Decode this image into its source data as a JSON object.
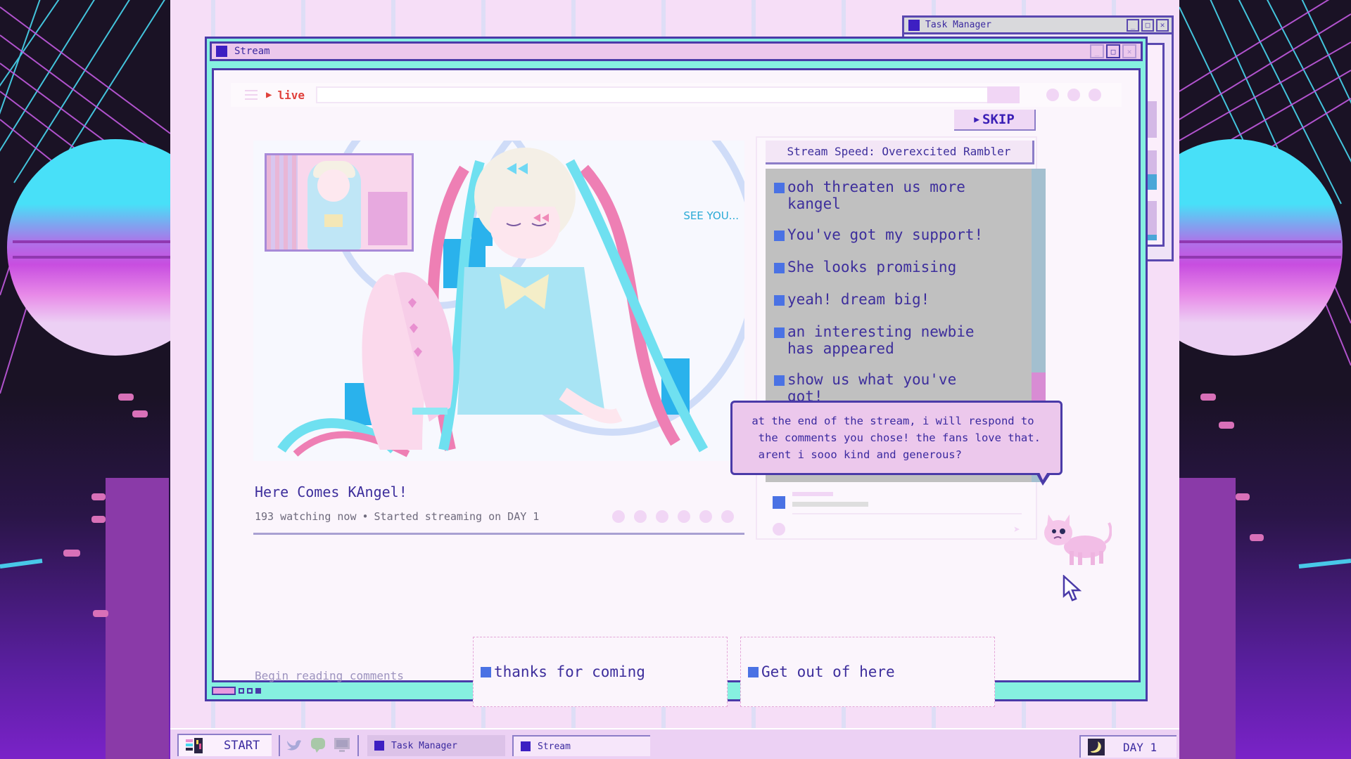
{
  "task_manager_window": {
    "title": "Task Manager",
    "icon": "window-icon",
    "controls": [
      "minimize",
      "maximize",
      "close"
    ]
  },
  "stream_window": {
    "title": "Stream",
    "icon": "window-icon",
    "controls": [
      "minimize",
      "maximize",
      "close"
    ],
    "live_label": "live",
    "live_icon": "play-icon",
    "menu_icon": "hamburger-icon"
  },
  "video": {
    "overlay_text": "SEE YOU...",
    "thumbnail": "character-thumbnail"
  },
  "stream_info": {
    "title": "Here Comes KAngel!",
    "watching": "193 watching now",
    "separator": "•",
    "started": "Started streaming on DAY 1"
  },
  "skip_button": {
    "label": "SKIP",
    "icon": "play-icon"
  },
  "stream_speed": "Stream Speed: Overexcited Rambler",
  "comments": [
    {
      "text": "ooh threaten us more\nkangel"
    },
    {
      "text": "You've got my support!"
    },
    {
      "text": "She looks promising"
    },
    {
      "text": "yeah! dream big!"
    },
    {
      "text": "an interesting newbie\nhas appeared"
    },
    {
      "text": "show us what you've\ngot!"
    }
  ],
  "speech_bubble": " at the end of the stream, i will respond to\n  the comments you chose! the fans love that.\n  arent i sooo kind and generous?",
  "bottom": {
    "begin_label": "Begin reading comments",
    "choices": [
      {
        "label": "thanks for coming"
      },
      {
        "label": "Get out of here"
      }
    ]
  },
  "taskbar": {
    "start_label": "START",
    "quick_icons": [
      "twitter-icon",
      "chat-icon",
      "monitor-icon"
    ],
    "tasks": [
      {
        "label": "Task Manager"
      },
      {
        "label": "Stream"
      }
    ],
    "day_label": "DAY 1",
    "day_icon": "moon-icon"
  },
  "colors": {
    "accent_indigo": "#3d1fc2",
    "window_border": "#4a3aa8",
    "window_frame_cyan": "#86f0e0",
    "title_pink": "#ecc8ec",
    "live_red": "#e0413c",
    "comment_blue": "#4a72e4",
    "desktop_pink": "#f6def7"
  }
}
